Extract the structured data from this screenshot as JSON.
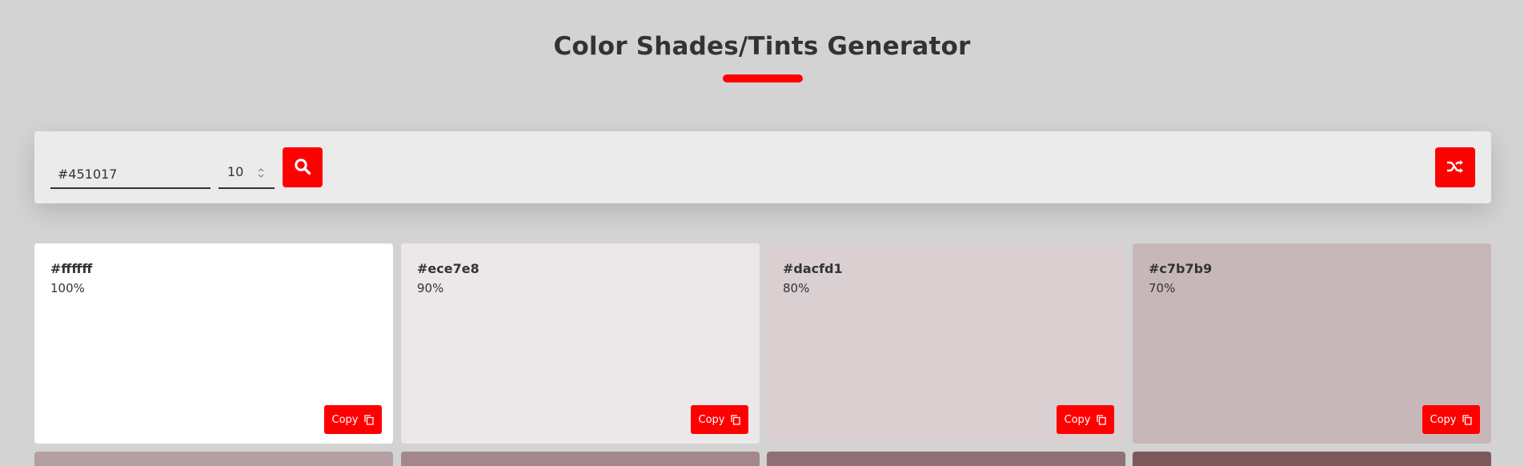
{
  "title": "Color Shades/Tints Generator",
  "colors": {
    "accent": "#ff0000",
    "background": "#d3d3d3",
    "toolbar": "#ebebeb"
  },
  "toolbar": {
    "color_value": "#451017",
    "count_value": "10",
    "search_icon": "search-icon",
    "shuffle_icon": "shuffle-icon"
  },
  "cards": [
    {
      "hex": "#ffffff",
      "pct": "100%",
      "copy_label": "Copy"
    },
    {
      "hex": "#ece7e8",
      "pct": "90%",
      "copy_label": "Copy"
    },
    {
      "hex": "#dacfd1",
      "pct": "80%",
      "copy_label": "Copy"
    },
    {
      "hex": "#c7b7b9",
      "pct": "70%",
      "copy_label": "Copy"
    }
  ],
  "row2_colors": [
    "#b49fa2",
    "#a2888b",
    "#8f7074",
    "#7c585d"
  ]
}
